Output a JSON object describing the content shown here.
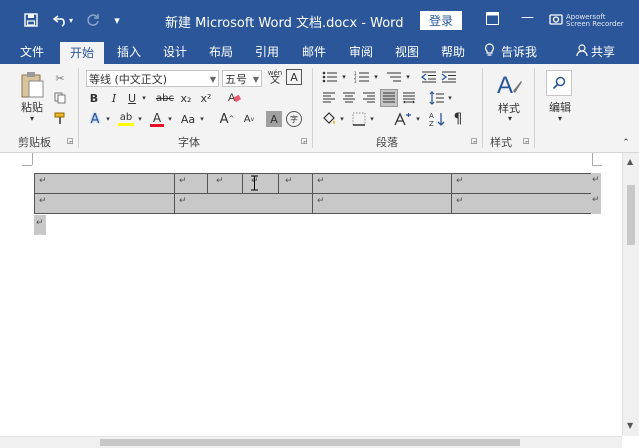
{
  "titlebar": {
    "title": "新建 Microsoft Word 文档.docx  -  Word",
    "login_label": "登录",
    "customize_label": "▾",
    "recorder_line1": "Apowersoft",
    "recorder_line2": "Screen Recorder",
    "minimize_label": "—"
  },
  "tabs": [
    {
      "label": "文件"
    },
    {
      "label": "开始"
    },
    {
      "label": "插入"
    },
    {
      "label": "设计"
    },
    {
      "label": "布局"
    },
    {
      "label": "引用"
    },
    {
      "label": "邮件"
    },
    {
      "label": "审阅"
    },
    {
      "label": "视图"
    },
    {
      "label": "帮助"
    },
    {
      "label": "告诉我"
    },
    {
      "label": "共享"
    }
  ],
  "clipboard": {
    "paste_label": "粘贴",
    "group_label": "剪贴板"
  },
  "font": {
    "font_name": "等线 (中文正文)",
    "font_size": "五号",
    "pinyin_label": "wén",
    "border_char_label": "A",
    "bold": "B",
    "italic": "I",
    "underline": "U",
    "strikethrough": "abc",
    "subscript": "x₂",
    "superscript": "x²",
    "text_effect": "A",
    "highlight": "ab",
    "font_color": "A",
    "change_case": "Aa",
    "grow_font": "A",
    "shrink_font": "A",
    "char_shading": "A",
    "enclose_char": "字",
    "group_label": "字体"
  },
  "paragraph": {
    "group_label": "段落"
  },
  "styles": {
    "label": "样式",
    "group_label": "样式"
  },
  "editing": {
    "label": "编辑"
  },
  "document": {
    "para_mark": "↵"
  },
  "colors": {
    "brand": "#2b579a",
    "highlight": "#ffff00",
    "font_color": "#e81123"
  }
}
